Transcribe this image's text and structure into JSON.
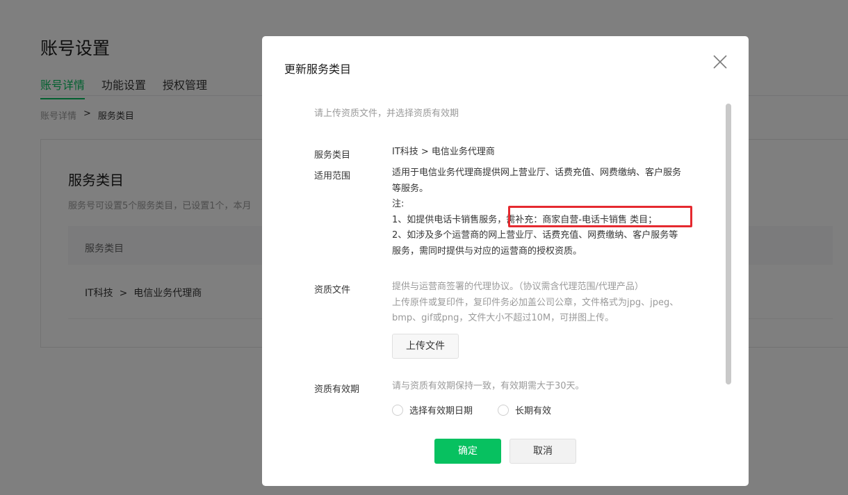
{
  "page": {
    "title": "账号设置",
    "tabs": [
      {
        "label": "账号详情"
      },
      {
        "label": "功能设置"
      },
      {
        "label": "授权管理"
      }
    ],
    "breadcrumb": {
      "parent": "账号详情",
      "separator": ">",
      "current": "服务类目"
    },
    "card": {
      "title": "服务类目",
      "desc": "服务号可设置5个服务类目，已设置1个，本月",
      "table_header": "服务类目",
      "rows": [
        {
          "category": "IT科技  >  电信业务代理商"
        }
      ]
    }
  },
  "dialog": {
    "title": "更新服务类目",
    "hint": "请上传资质文件，并选择资质有效期",
    "service_category": {
      "label": "服务类目",
      "value": "IT科技 > 电信业务代理商"
    },
    "scope": {
      "label": "适用范围",
      "line1": "适用于电信业务代理商提供网上营业厅、话费充值、网费缴纳、客户服务",
      "line2": "等服务。",
      "line3": "注:",
      "line4": "1、如提供电话卡销售服务，需补充：商家自营-电话卡销售 类目；",
      "line5": "2、如涉及多个运营商的网上营业厅、话费充值、网费缴纳、客户服务等",
      "line6": "服务，需同时提供与对应的运营商的授权资质。"
    },
    "qualification": {
      "label": "资质文件",
      "line1": "提供与运营商签署的代理协议。（协议需含代理范围/代理产品）",
      "line2": "上传原件或复印件，复印件务必加盖公司公章，文件格式为jpg、jpeg、",
      "line3": "bmp、gif或png，文件大小不超过10M，可拼图上传。",
      "upload_label": "上传文件"
    },
    "validity": {
      "label": "资质有效期",
      "hint": "请与资质有效期保持一致，有效期需大于30天。",
      "option1": "选择有效期日期",
      "option2": "长期有效"
    },
    "ok_label": "确定",
    "cancel_label": "取消"
  },
  "colors": {
    "accent": "#07c160",
    "highlight": "#e5292f",
    "overlay": "rgba(0,0,0,0.5)"
  }
}
